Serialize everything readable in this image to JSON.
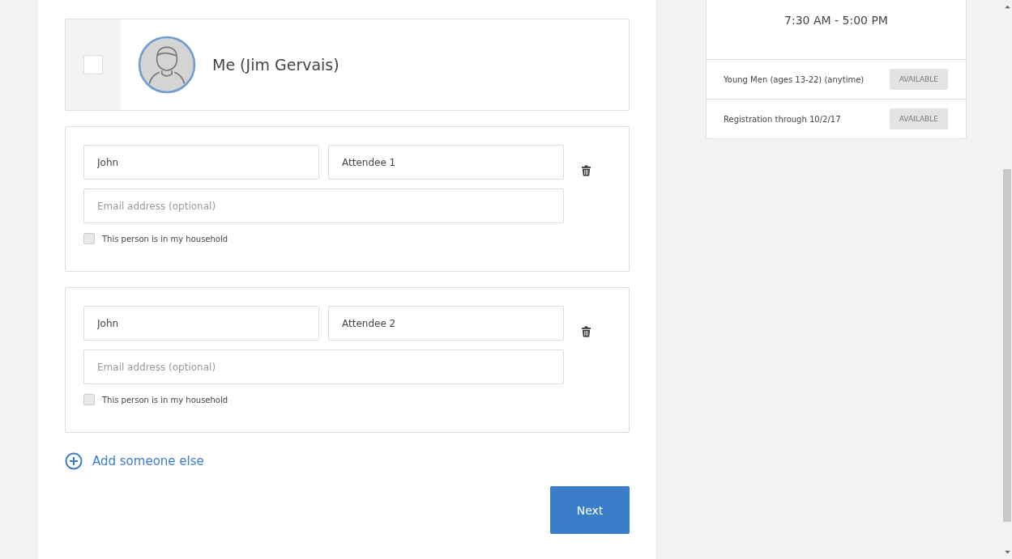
{
  "me": {
    "name": "Me (Jim Gervais)",
    "checked": false
  },
  "attendees": [
    {
      "first_name": "John",
      "last_name": "Attendee 1",
      "email": {
        "placeholder": "Email address (optional)"
      },
      "household": {
        "label": "This person is in my household",
        "checked": false
      }
    },
    {
      "first_name": "John",
      "last_name": "Attendee 2",
      "email": {
        "placeholder": "Email address (optional)"
      },
      "household": {
        "label": "This person is in my household",
        "checked": false
      }
    }
  ],
  "add_link": "Add someone else",
  "next_button": "Next",
  "schedule": {
    "time": "7:30 AM - 5:00 PM",
    "rows": [
      {
        "label": "Young Men (ages 13-22) (anytime)",
        "status": "AVAILABLE"
      },
      {
        "label": "Registration through 10/2/17",
        "status": "AVAILABLE"
      }
    ]
  }
}
